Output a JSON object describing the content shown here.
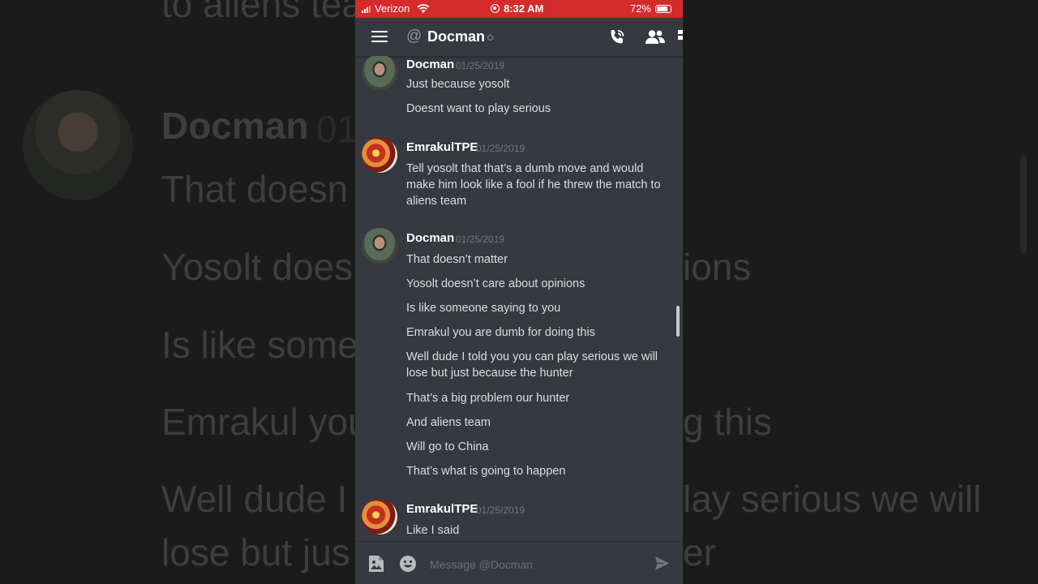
{
  "statusbar": {
    "carrier": "Verizon",
    "time": "8:32 AM",
    "battery": "72%",
    "battery_level": 0.72
  },
  "header": {
    "at_icon": "at-icon",
    "title": "Docman"
  },
  "messages": [
    {
      "author": "Docman",
      "timestamp": "01/25/2019",
      "avatar": "docman-avatar",
      "lines": [
        "Just because yosolt",
        "Doesnt want to play serious"
      ]
    },
    {
      "author": "EmrakulTPE",
      "timestamp": "01/25/2019",
      "avatar": "emrakul-avatar",
      "lines": [
        "Tell yosolt that that’s a dumb move and would make him look like a fool if he threw the match to aliens team"
      ]
    },
    {
      "author": "Docman",
      "timestamp": "01/25/2019",
      "avatar": "docman-avatar",
      "lines": [
        "That doesn’t matter",
        "Yosolt doesn’t care about opinions",
        "Is like someone saying to you",
        "Emrakul you are dumb for doing this",
        "Well dude I told you you can play serious we will lose but just because the hunter",
        "That’s a big problem our hunter",
        "And aliens team",
        "Will go to China",
        "That’s what is going to happen"
      ]
    },
    {
      "author": "EmrakulTPE",
      "timestamp": "01/25/2019",
      "avatar": "emrakul-avatar",
      "lines": [
        "Like I said"
      ]
    }
  ],
  "composer": {
    "placeholder": "Message @Docman"
  },
  "backdrop": {
    "lines": [
      "to aliens team",
      "Docman",
      "01/",
      "That doesn",
      "Yosolt does",
      "ions",
      "Is like some",
      "Emrakul you",
      "g this",
      "Well dude I",
      "lay serious we will",
      "lose but jus",
      "er"
    ]
  },
  "colors": {
    "statusbar": "#d62b2b",
    "background": "#36393f",
    "text": "#dcddde",
    "timestamp": "#72767d"
  }
}
